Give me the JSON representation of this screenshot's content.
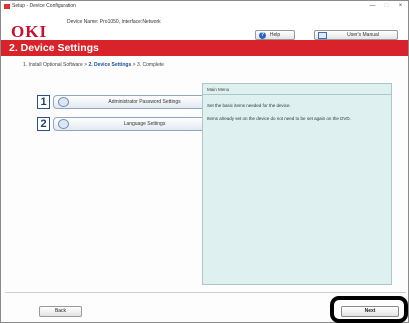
{
  "window": {
    "title": "Setup - Device Configuration",
    "controls": {
      "minimize": "—",
      "maximize": "□",
      "close": "×"
    }
  },
  "header": {
    "logo": "OKI",
    "device_name": "Device Name: Pro1050, Interface:Network",
    "help_label": "Help",
    "help_icon_glyph": "?",
    "manual_label": "User's Manual"
  },
  "banner": {
    "title": "2. Device Settings",
    "color": "#d8232a"
  },
  "breadcrumb": {
    "step1": "1. Install Optional Software >",
    "step2": "2. Device Settings",
    "step3": "> 3. Complete"
  },
  "menu": {
    "items": [
      {
        "number": "1",
        "label": "Administrator Password Settings",
        "icon": "lock-icon"
      },
      {
        "number": "2",
        "label": "Language Settings",
        "icon": "globe-icon"
      }
    ]
  },
  "info": {
    "title": "Main Menu",
    "line1": "Set the basic items needed for the device.",
    "line2": "Items already set on the device do not need to be set again on the DVD."
  },
  "footer": {
    "back_label": "Back",
    "next_label": "Next"
  }
}
